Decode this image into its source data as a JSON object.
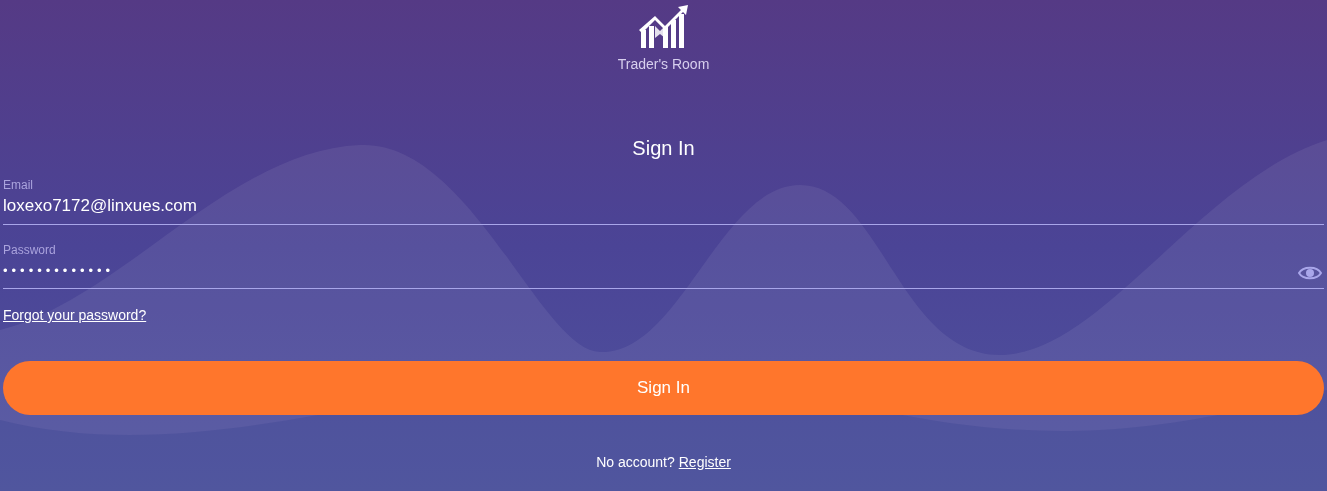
{
  "brand": {
    "title": "Trader's Room"
  },
  "form": {
    "heading": "Sign In",
    "fields": [
      {
        "kind": "text",
        "label": "Email",
        "value": "loxexo7172@linxues.com"
      },
      {
        "kind": "password",
        "label": "Password",
        "value": "•••••••••••••"
      }
    ],
    "forgot_link": "Forgot your password?",
    "submit": "Sign In",
    "register_prompt": "No account?",
    "register_link": "Register"
  }
}
